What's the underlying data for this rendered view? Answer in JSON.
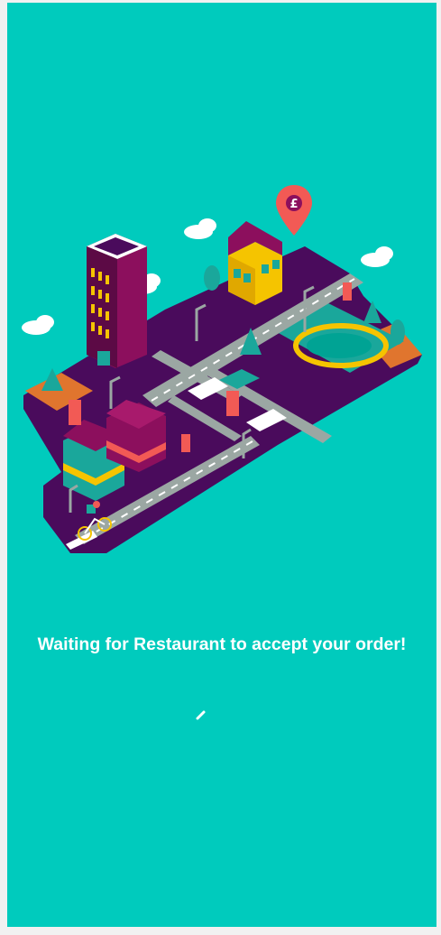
{
  "app": {
    "background_color": "#00cbbd",
    "accent_colors": {
      "road": "#4a0b5c",
      "street": "#9ba7a3",
      "building_magenta": "#8c0f5d",
      "building_yellow": "#f5c400",
      "pin": "#f25a55"
    }
  },
  "illustration": {
    "icon": "isometric-city-delivery-icon",
    "pin_icon": "pound-location-pin-icon",
    "pin_symbol": "£"
  },
  "status": {
    "message": "Waiting for Restaurant to accept your order!"
  },
  "loader": {
    "icon": "loading-spinner-icon"
  }
}
